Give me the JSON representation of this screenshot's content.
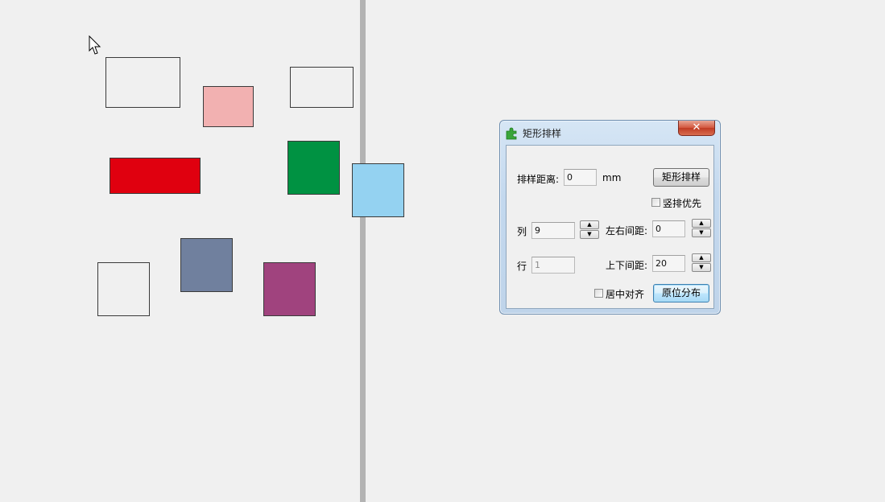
{
  "canvas": {
    "shapes": [
      {
        "name": "rect-outline-1",
        "color": "transparent"
      },
      {
        "name": "rect-pink",
        "color": "#f2b1b1"
      },
      {
        "name": "rect-outline-2",
        "color": "transparent"
      },
      {
        "name": "rect-red",
        "color": "#e0000f"
      },
      {
        "name": "rect-green",
        "color": "#009242"
      },
      {
        "name": "rect-light-blue",
        "color": "#94d2f1"
      },
      {
        "name": "rect-outline-3",
        "color": "transparent"
      },
      {
        "name": "rect-slate-blue",
        "color": "#70809e"
      },
      {
        "name": "rect-purple",
        "color": "#a0437e"
      }
    ]
  },
  "dialog": {
    "title": "矩形排样",
    "icon": "puzzle-icon",
    "close_label": "✕",
    "spacing": {
      "label": "排样距离:",
      "value": "0",
      "unit": "mm"
    },
    "arrange_button": "矩形排样",
    "vertical_first": {
      "label": "竖排优先",
      "checked": false
    },
    "columns": {
      "label": "列",
      "value": "9"
    },
    "rows": {
      "label": "行",
      "value": "1"
    },
    "h_gap": {
      "label": "左右间距:",
      "value": "0"
    },
    "v_gap": {
      "label": "上下间距:",
      "value": "20"
    },
    "center_align": {
      "label": "居中对齐",
      "checked": false
    },
    "reset_button": "原位分布",
    "spin_up": "▲",
    "spin_down": "▼"
  }
}
